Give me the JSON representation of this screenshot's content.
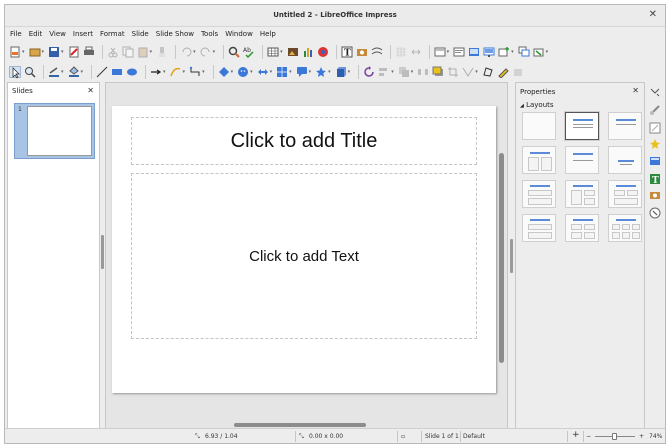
{
  "window": {
    "title": "Untitled 2 - LibreOffice Impress",
    "close_glyph": "✕"
  },
  "menu": [
    "File",
    "Edit",
    "View",
    "Insert",
    "Format",
    "Slide",
    "Slide Show",
    "Tools",
    "Window",
    "Help"
  ],
  "slides_pane": {
    "title": "Slides",
    "close_glyph": "✕",
    "slide_number": "1"
  },
  "slide": {
    "title_placeholder": "Click to add Title",
    "text_placeholder": "Click to add Text"
  },
  "properties": {
    "title": "Properties",
    "close_glyph": "✕",
    "section": "Layouts",
    "section_arrow": "◢",
    "selected_layout": "Title, Content"
  },
  "status": {
    "position": "6.93 / 1.04",
    "size": "0.00 x 0.00",
    "slide_info": "Slide 1 of 1",
    "master": "Default",
    "zoom_level": "74%",
    "zoom_minus": "−",
    "zoom_plus": "+",
    "fit_button": "+"
  },
  "icons": {
    "toolbar1": [
      "new-icon",
      "open-icon",
      "save-icon",
      "export-pdf-icon",
      "print-icon",
      "cut-icon",
      "copy-icon",
      "paste-icon",
      "clone-format-icon",
      "undo-icon",
      "redo-icon",
      "find-replace-icon",
      "spellcheck-icon",
      "table-icon",
      "image-icon",
      "chart-icon",
      "media-icon",
      "textbox-icon",
      "special-char-icon",
      "fontwork-icon",
      "grid-icon",
      "helplines-icon",
      "slide-layout-icon",
      "master-slide-icon",
      "display-views-icon",
      "start-show-icon",
      "new-slide-icon",
      "duplicate-slide-icon",
      "delete-slide-icon"
    ],
    "toolbar2": [
      "select-icon",
      "zoom-icon",
      "line-color-icon",
      "fill-color-icon",
      "line-icon",
      "rectangle-icon",
      "ellipse-icon",
      "arrow-line-icon",
      "curve-icon",
      "connector-icon",
      "basic-shapes-icon",
      "symbol-shapes-icon",
      "block-arrows-icon",
      "flowchart-icon",
      "callout-icon",
      "stars-icon",
      "3d-objects-icon",
      "rotate-icon",
      "align-icon",
      "arrange-icon",
      "distribute-icon",
      "shadow-icon",
      "crop-icon",
      "filter-icon",
      "points-icon",
      "glue-points-icon",
      "toggle-extrusion-icon"
    ]
  },
  "colors": {
    "accent_blue": "#3b78d8",
    "selection_blue": "#a8c4e4"
  }
}
